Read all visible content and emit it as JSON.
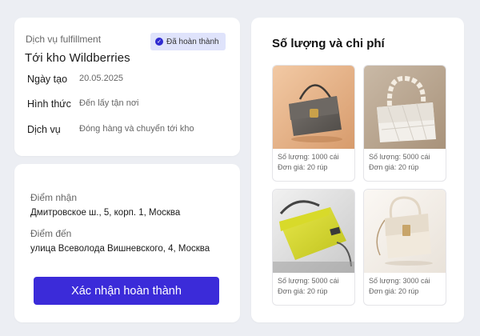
{
  "order": {
    "service_label": "Dịch vụ fulfillment",
    "status_badge": "Đã hoàn thành",
    "title": "Tới kho Wildberries",
    "details": [
      {
        "label": "Ngày tạo",
        "value": "20.05.2025"
      },
      {
        "label": "Hình thức",
        "value": "Đến lấy tận nơi"
      },
      {
        "label": "Dịch vụ",
        "value": "Đóng hàng và chuyển tới kho"
      }
    ]
  },
  "route": {
    "pickup_label": "Điểm nhận",
    "pickup_address": "Дмитровское ш., 5, корп. 1, Москва",
    "destination_label": "Điểm đến",
    "destination_address": "улица Всеволода Вишневского, 4, Москва",
    "confirm_button": "Xác nhận hoàn thành"
  },
  "products": {
    "title": "Số lượng và chi phí",
    "items": [
      {
        "quantity": "Số lượng: 1000 cái",
        "price": "Đơn giá: 20 rúp",
        "image": "gray-leather-handbag"
      },
      {
        "quantity": "Số lượng: 5000 cái",
        "price": "Đơn giá: 20 rúp",
        "image": "white-quilted-chain-handbag"
      },
      {
        "quantity": "Số lượng: 5000 cái",
        "price": "Đơn giá: 20 rúp",
        "image": "yellow-textured-handbag"
      },
      {
        "quantity": "Số lượng: 3000 cái",
        "price": "Đơn giá: 20 rúp",
        "image": "cream-leather-handbag"
      }
    ]
  },
  "colors": {
    "accent": "#3b2bd9",
    "badge_bg": "#dfe3fb",
    "background": "#eceef3"
  }
}
